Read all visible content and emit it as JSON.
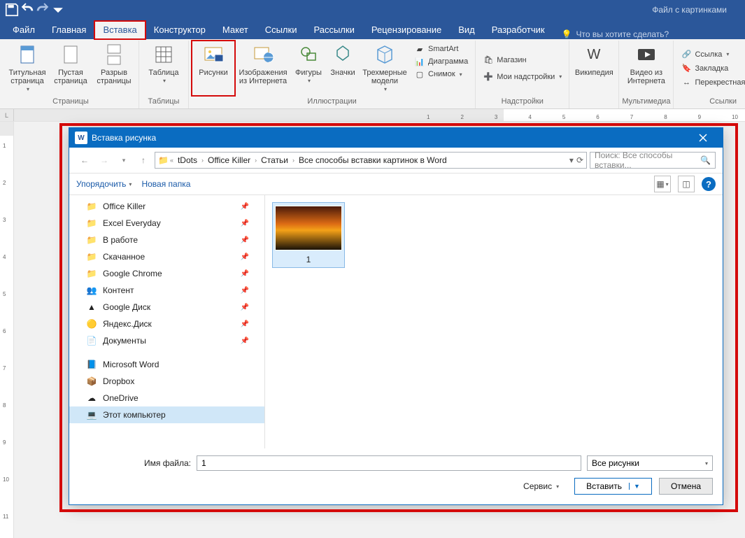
{
  "title_bar": {
    "document_title": "Файл с картинками"
  },
  "tabs": {
    "file": "Файл",
    "home": "Главная",
    "insert": "Вставка",
    "design": "Конструктор",
    "layout": "Макет",
    "references": "Ссылки",
    "mailings": "Рассылки",
    "review": "Рецензирование",
    "view": "Вид",
    "developer": "Разработчик",
    "tellme": "Что вы хотите сделать?"
  },
  "ribbon": {
    "pages": {
      "label": "Страницы",
      "cover": "Титульная страница",
      "blank": "Пустая страница",
      "break": "Разрыв страницы"
    },
    "tables": {
      "label": "Таблицы",
      "table": "Таблица"
    },
    "illustrations": {
      "label": "Иллюстрации",
      "pictures": "Рисунки",
      "online": "Изображения из Интернета",
      "shapes": "Фигуры",
      "icons": "Значки",
      "models3d": "Трехмерные модели",
      "smartart": "SmartArt",
      "chart": "Диаграмма",
      "screenshot": "Снимок"
    },
    "addins": {
      "label": "Надстройки",
      "store": "Магазин",
      "myaddins": "Мои надстройки"
    },
    "wikipedia": {
      "label": "",
      "btn": "Википедия"
    },
    "media": {
      "label": "Мультимедиа",
      "video": "Видео из Интернета"
    },
    "links": {
      "label": "Ссылки",
      "link": "Ссылка",
      "bookmark": "Закладка",
      "crossref": "Перекрестная ссыл"
    }
  },
  "dialog": {
    "title": "Вставка рисунка",
    "breadcrumb": [
      "tDots",
      "Office Killer",
      "Статьи",
      "Все способы вставки картинок в Word"
    ],
    "search_placeholder": "Поиск: Все способы вставки...",
    "organize": "Упорядочить",
    "new_folder": "Новая папка",
    "tree": [
      {
        "icon": "folder",
        "label": "Office Killer",
        "pin": true
      },
      {
        "icon": "folder",
        "label": "Excel Everyday",
        "pin": true
      },
      {
        "icon": "folder",
        "label": "В работе",
        "pin": true
      },
      {
        "icon": "folder",
        "label": "Скачанное",
        "pin": true
      },
      {
        "icon": "folder",
        "label": "Google Chrome",
        "pin": true
      },
      {
        "icon": "contacts",
        "label": "Контент",
        "pin": true
      },
      {
        "icon": "gdrive",
        "label": "Google Диск",
        "pin": true
      },
      {
        "icon": "ydisk",
        "label": "Яндекс.Диск",
        "pin": true
      },
      {
        "icon": "docs",
        "label": "Документы",
        "pin": true
      },
      {
        "icon": "word",
        "label": "Microsoft Word"
      },
      {
        "icon": "dropbox",
        "label": "Dropbox"
      },
      {
        "icon": "onedrive",
        "label": "OneDrive"
      },
      {
        "icon": "pc",
        "label": "Этот компьютер",
        "sel": true
      }
    ],
    "file_item": {
      "name": "1"
    },
    "file_label": "Имя файла:",
    "file_value": "1",
    "filter": "Все рисунки",
    "service": "Сервис",
    "insert": "Вставить",
    "cancel": "Отмена"
  }
}
